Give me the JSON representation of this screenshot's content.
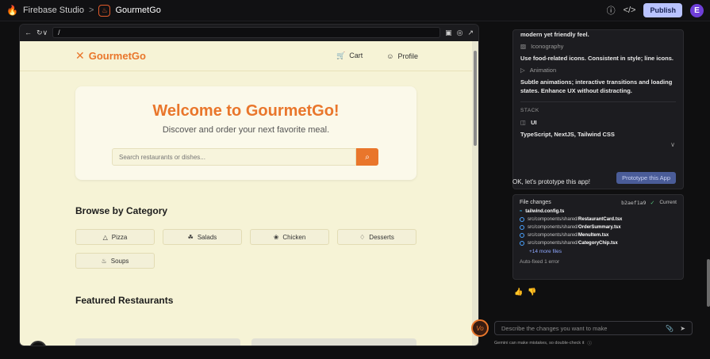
{
  "topbar": {
    "studio": "Firebase Studio",
    "separator": ">",
    "project": "GourmetGo",
    "help_icon": "help-icon",
    "code_icon": "code-icon",
    "publish": "Publish",
    "avatar": "E"
  },
  "browser": {
    "url": "/"
  },
  "site": {
    "brand": "GourmetGo",
    "cart": "Cart",
    "profile": "Profile",
    "hero_title": "Welcome to GourmetGo!",
    "hero_subtitle": "Discover and order your next favorite meal.",
    "search_placeholder": "Search restaurants or dishes...",
    "browse_title": "Browse by Category",
    "categories": [
      "Pizza",
      "Salads",
      "Chicken",
      "Desserts",
      "Soups"
    ],
    "featured_title": "Featured Restaurants",
    "n_badge": "N",
    "accent": "#e9762b",
    "background": "#f6f3d6"
  },
  "panel": {
    "style_top": "modern yet friendly feel.",
    "iconography_label": "Iconography",
    "iconography_text": "Use food-related icons. Consistent in style; line icons.",
    "animation_label": "Animation",
    "animation_text": "Subtle animations; interactive transitions and loading states. Enhance UX without distracting.",
    "stack_label": "STACK",
    "ui_label": "UI",
    "stack_text": "TypeScript, NextJS, Tailwind CSS",
    "prototype_button": "Prototype this App",
    "message": "OK, let's prototype this app!",
    "file_changes": "File changes",
    "hash": "b2aef1a9",
    "current": "Current",
    "files": [
      {
        "prefix": "",
        "name": "tailwind.config.ts"
      },
      {
        "prefix": "src/components/shared/",
        "name": "RestaurantCard.tsx"
      },
      {
        "prefix": "src/components/shared/",
        "name": "OrderSummary.tsx"
      },
      {
        "prefix": "src/components/shared/",
        "name": "MenuItem.tsx"
      },
      {
        "prefix": "src/components/shared/",
        "name": "CategoryChip.tsx"
      }
    ],
    "more_files": "+14 more files",
    "autofix": "Auto-fixed 1 error",
    "chat_placeholder": "Describe the changes you want to make",
    "gemini_note": "Gemini can make mistakes, so double-check it"
  }
}
